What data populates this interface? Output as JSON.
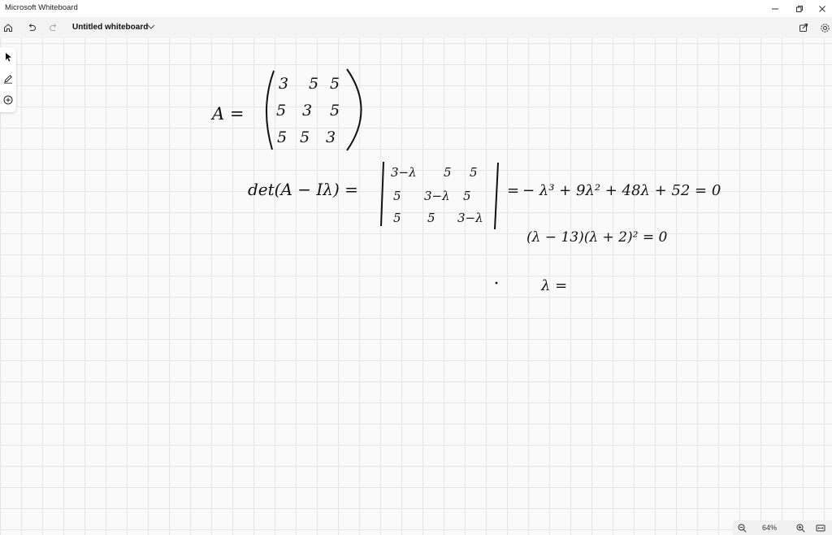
{
  "app": {
    "title": "Microsoft Whiteboard"
  },
  "toolbar": {
    "board_title": "Untitled whiteboard"
  },
  "icons": {
    "minimize": "minimize-icon",
    "restore": "restore-icon",
    "close": "close-icon",
    "home": "home-icon",
    "undo": "undo-icon",
    "redo": "redo-icon",
    "share": "share-icon",
    "settings": "gear-icon",
    "select": "pointer-icon",
    "pen": "pen-icon",
    "add": "add-icon",
    "zoom_out": "zoom-out-icon",
    "zoom_in": "zoom-in-icon",
    "fit": "fit-to-screen-icon"
  },
  "zoom": {
    "level": "64%"
  },
  "ink": {
    "line1": "A =",
    "matrix_rows": [
      [
        "3",
        "5",
        "5"
      ],
      [
        "5",
        "3",
        "5"
      ],
      [
        "5",
        "5",
        "3"
      ]
    ],
    "det_label": "det(A − Iλ) =",
    "det_rows": [
      [
        "3−λ",
        "5",
        "5"
      ],
      [
        "5",
        "3−λ",
        "5"
      ],
      [
        "5",
        "5",
        "3−λ"
      ]
    ],
    "equals_sign": "=",
    "polynomial": "− λ³ + 9λ² + 48λ + 52 = 0",
    "factored": "(λ − 13)(λ + 2)² = 0",
    "lambda_line": "λ ="
  },
  "colors": {
    "ink": "#111111",
    "grid": "#e6e6e6",
    "canvas": "#fafafa"
  }
}
